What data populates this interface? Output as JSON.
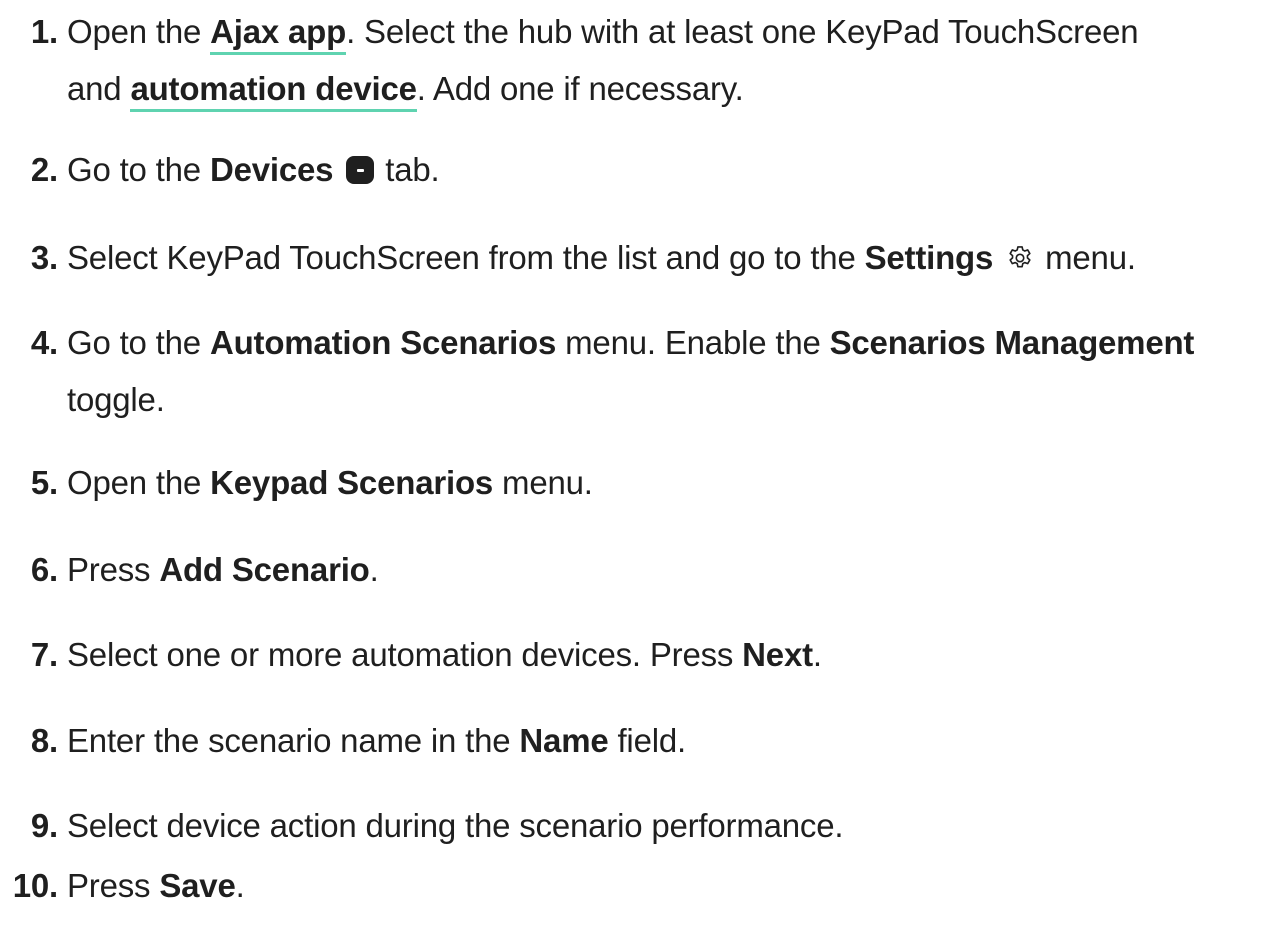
{
  "steps": [
    {
      "number": "1.",
      "line1": {
        "t1": "Open the ",
        "link1": "Ajax app",
        "t2": ". Select the hub with at least one KeyPad TouchScreen"
      },
      "line2": {
        "t1": "and ",
        "link2": "automation device",
        "t2": ". Add one if necessary."
      }
    },
    {
      "number": "2.",
      "t1": "Go to the ",
      "b1": "Devices",
      "t2": " tab.",
      "icon": "devices-icon"
    },
    {
      "number": "3.",
      "t1": "Select KeyPad TouchScreen from the list and go to the ",
      "b1": "Settings",
      "t2": " menu.",
      "icon": "gear-icon"
    },
    {
      "number": "4.",
      "line1": {
        "t1": "Go to the ",
        "b1": "Automation Scenarios",
        "t2": " menu. Enable the ",
        "b2": "Scenarios Management"
      },
      "line2": {
        "t1": "toggle."
      }
    },
    {
      "number": "5.",
      "t1": "Open the ",
      "b1": "Keypad Scenarios",
      "t2": " menu."
    },
    {
      "number": "6.",
      "t1": "Press ",
      "b1": "Add Scenario",
      "t2": "."
    },
    {
      "number": "7.",
      "t1": "Select one or more automation devices. Press ",
      "b1": "Next",
      "t2": "."
    },
    {
      "number": "8.",
      "t1": "Enter the scenario name in the ",
      "b1": "Name",
      "t2": " field."
    },
    {
      "number": "9.",
      "t1": "Select device action during the scenario performance."
    },
    {
      "number": "10.",
      "t1": "Press ",
      "b1": "Save",
      "t2": "."
    }
  ],
  "colors": {
    "text": "#1f1f1f",
    "link_underline": "#5fd3b0"
  }
}
